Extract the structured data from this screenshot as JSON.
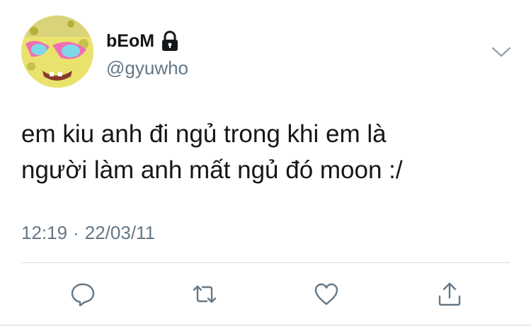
{
  "author": {
    "display_name": "bEoM",
    "handle": "@gyuwho",
    "avatar_icon": "spongebob-avatar-icon",
    "protected_icon": "lock-icon"
  },
  "tweet": {
    "lines": [
      "em kiu anh đi ngủ trong khi em là",
      "người làm anh mất ngủ đó moon :/"
    ],
    "time": "12:19",
    "separator": "·",
    "date": "22/03/11"
  },
  "actions": {
    "reply_icon": "reply-icon",
    "retweet_icon": "retweet-icon",
    "like_icon": "heart-icon",
    "share_icon": "share-icon",
    "menu_icon": "chevron-down-icon"
  },
  "colors": {
    "text": "#14171a",
    "secondary": "#657786",
    "accent": "#1da1f2",
    "divider": "#d7dde2"
  }
}
